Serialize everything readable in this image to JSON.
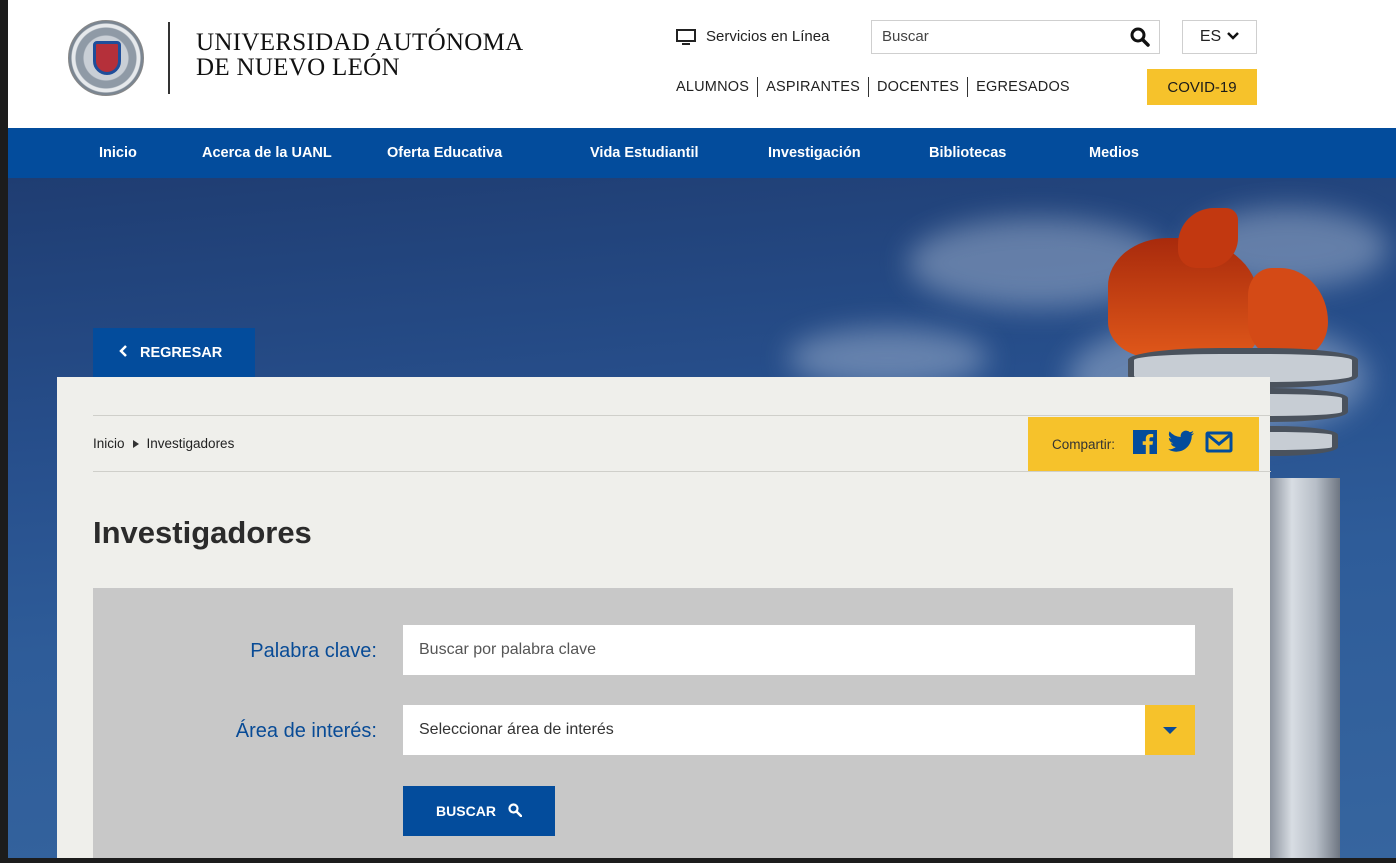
{
  "header": {
    "university_line1": "UNIVERSIDAD AUTÓNOMA",
    "university_line2": "DE NUEVO LEÓN",
    "services_label": "Servicios en Línea",
    "search_placeholder": "Buscar",
    "language": "ES",
    "audience_links": [
      "ALUMNOS",
      "ASPIRANTES",
      "DOCENTES",
      "EGRESADOS"
    ],
    "covid_label": "COVID-19"
  },
  "nav": {
    "items": [
      "Inicio",
      "Acerca de la UANL",
      "Oferta Educativa",
      "Vida Estudiantil",
      "Investigación",
      "Bibliotecas",
      "Medios"
    ]
  },
  "back_button": "REGRESAR",
  "breadcrumb": {
    "home": "Inicio",
    "current": "Investigadores"
  },
  "share": {
    "label": "Compartir:",
    "icons": [
      "facebook-icon",
      "twitter-icon",
      "mail-icon"
    ]
  },
  "page_title": "Investigadores",
  "form": {
    "keyword_label": "Palabra clave:",
    "keyword_placeholder": "Buscar por palabra clave",
    "area_label": "Área de interés:",
    "area_selected": "Seleccionar área de interés",
    "search_button": "BUSCAR"
  },
  "colors": {
    "primary_blue": "#034c9c",
    "accent_yellow": "#f6c22b",
    "panel_bg": "#efefeb",
    "form_bg": "#c8c8c8"
  }
}
